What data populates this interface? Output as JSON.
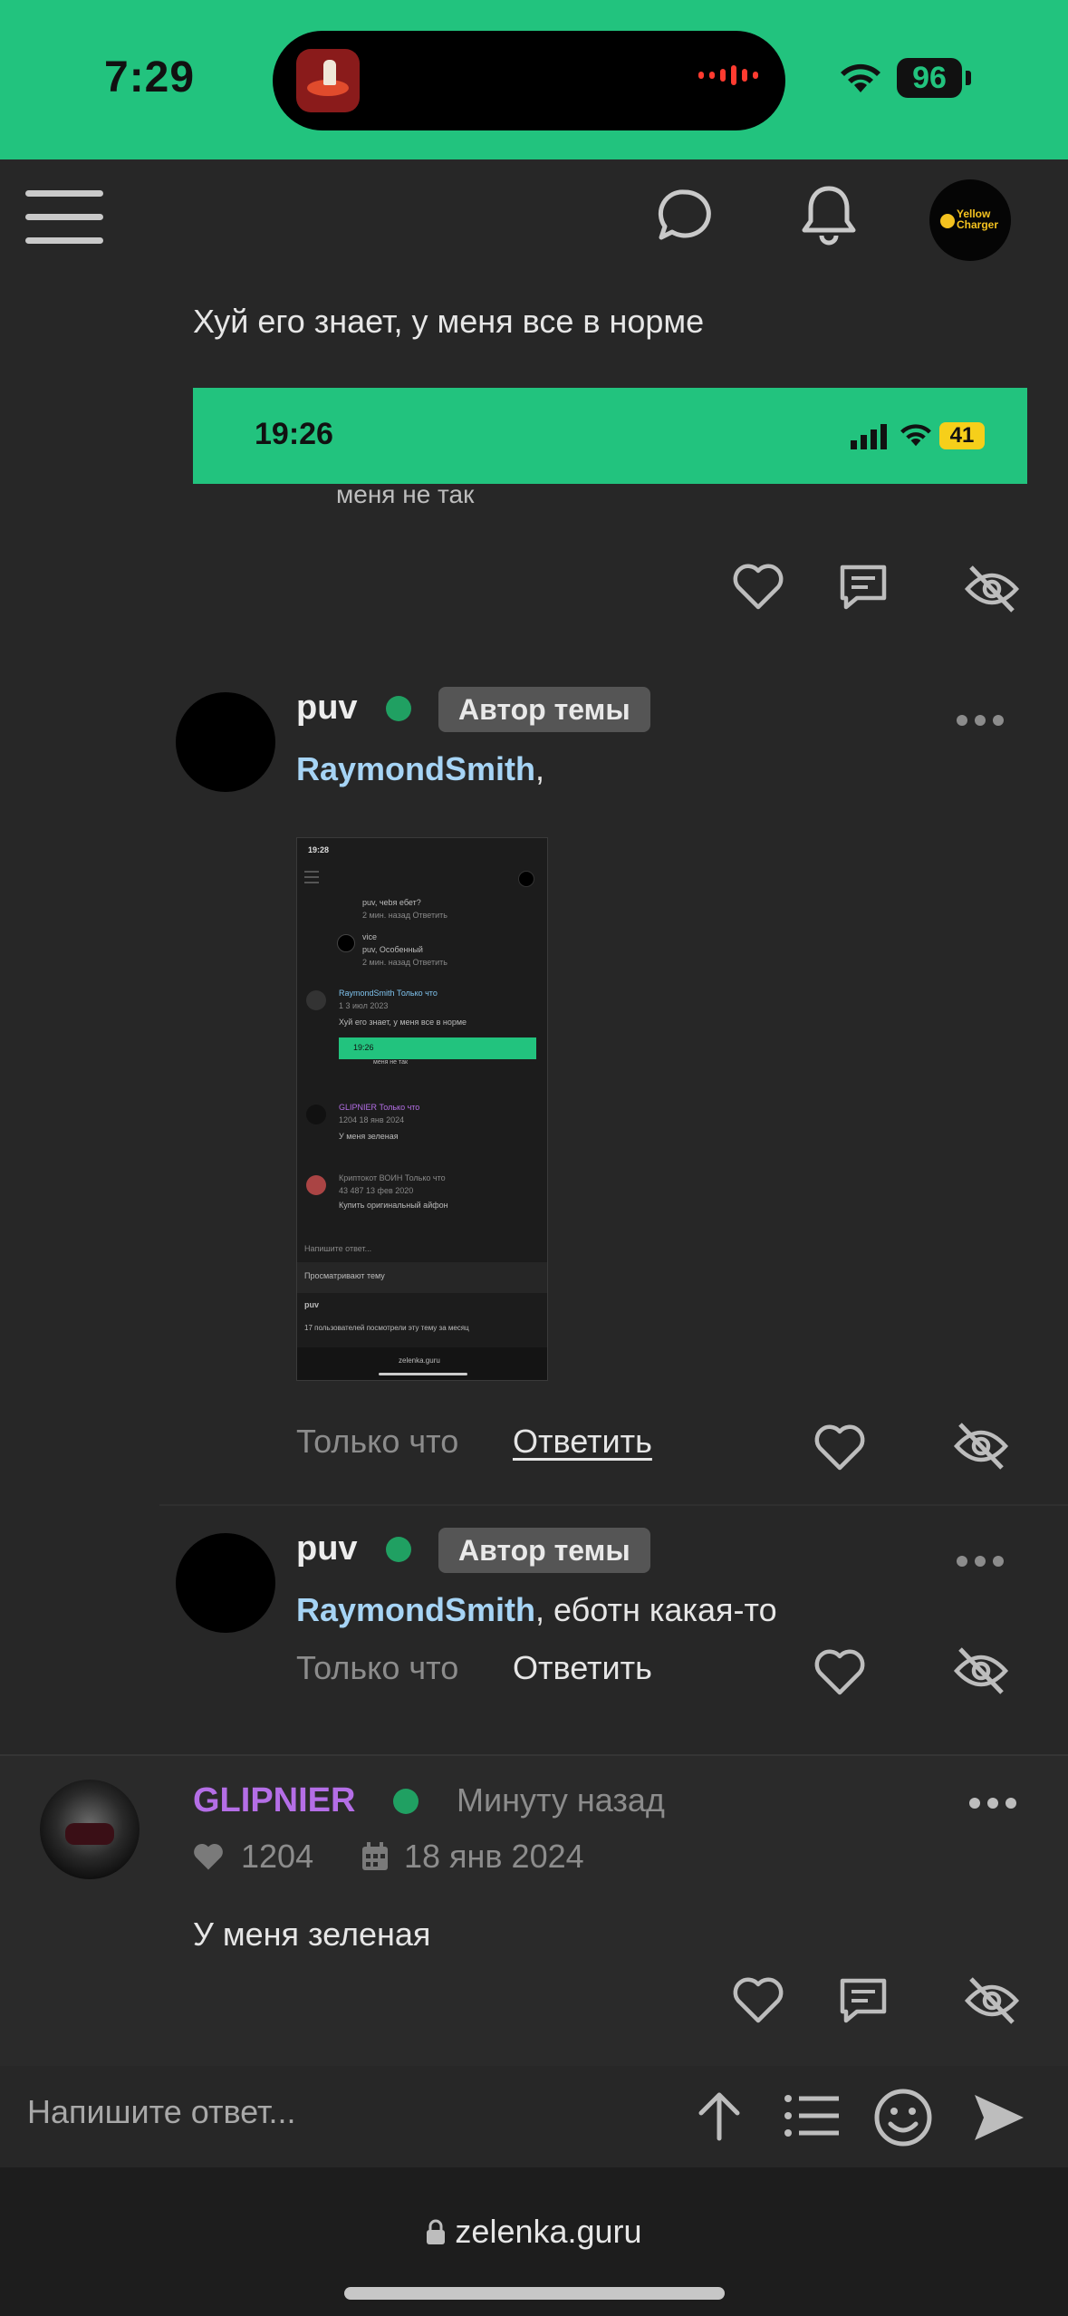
{
  "status_bar": {
    "time": "7:29",
    "battery": "96"
  },
  "header": {
    "menu_icon": "hamburger-icon",
    "chat_icon": "chat-bubble-icon",
    "bell_icon": "bell-icon",
    "avatar_text": "Yellow Charger"
  },
  "quoted_post": {
    "text": "Хуй его знает, у меня все в норме",
    "embed_time": "19:26",
    "embed_battery": "41",
    "embed_caption": "меня не так"
  },
  "comments": [
    {
      "user": "puv",
      "badge": "Автор темы",
      "mention": "RaymondSmith",
      "text": ",",
      "time": "Только что",
      "reply": "Ответить",
      "thumbnail": {
        "time": "19:28",
        "lines": [
          "puv, чеbя ебет?",
          "2 мин. назад  Ответить",
          "vice",
          "puv, Особенный",
          "2 мин. назад  Ответить",
          "RaymondSmith  Только что",
          "1   3 июл 2023",
          "Хуй его знает, у меня все в норме",
          "19:26",
          "меня не так",
          "GLIPNIER  Только что",
          "1204   18 янв 2024",
          "У меня зеленая",
          "Криптокот  ВОИН  Только что",
          "43 487   13 фев 2020",
          "Купить оригинальный айфон",
          "Напишите ответ...",
          "Просматривают тему",
          "puv",
          "17 пользователей посмотрели эту тему за месяц",
          "zelenka.guru"
        ]
      }
    },
    {
      "user": "puv",
      "badge": "Автор темы",
      "mention": "RaymondSmith",
      "text": ", еботн какая-то",
      "time": "Только что",
      "reply": "Ответить"
    }
  ],
  "post": {
    "user": "GLIPNIER",
    "time": "Минуту назад",
    "likes": "1204",
    "date": "18 янв 2024",
    "text": "У меня зеленая"
  },
  "composer": {
    "placeholder": "Напишите ответ..."
  },
  "browser": {
    "url": "zelenka.guru"
  },
  "colors": {
    "accent": "#22c37e",
    "mention": "#a6d4f5",
    "glipnier": "#b46ee6",
    "online": "#20a062"
  }
}
